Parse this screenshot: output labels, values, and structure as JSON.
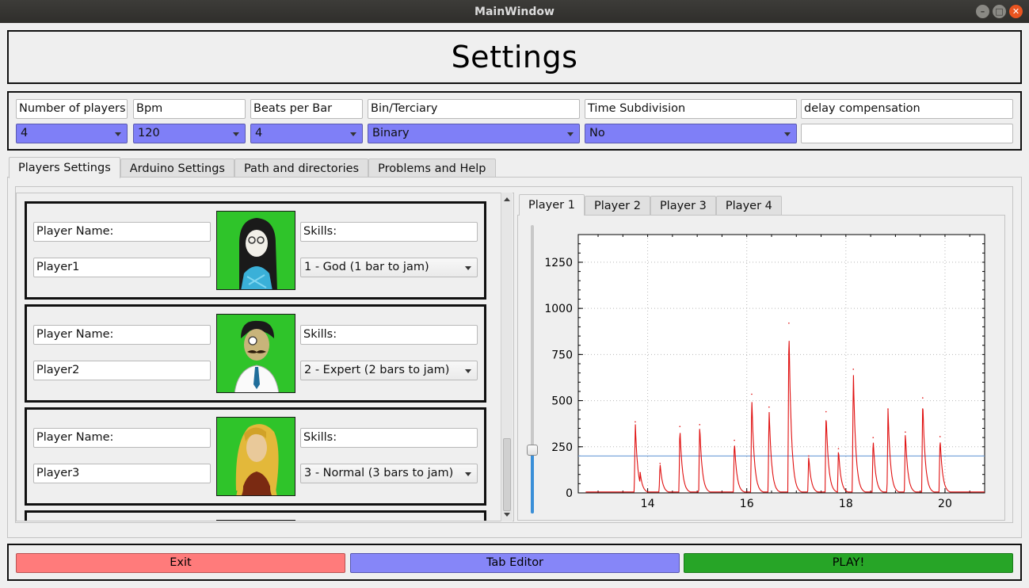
{
  "window": {
    "title": "MainWindow"
  },
  "header": {
    "title": "Settings"
  },
  "params": [
    {
      "label": "Number of players",
      "value": "4",
      "type": "combo"
    },
    {
      "label": "Bpm",
      "value": "120",
      "type": "combo"
    },
    {
      "label": "Beats per Bar",
      "value": "4",
      "type": "combo"
    },
    {
      "label": "Bin/Terciary",
      "value": "Binary",
      "type": "combo"
    },
    {
      "label": "Time Subdivision",
      "value": "No",
      "type": "combo"
    },
    {
      "label": "delay compensation",
      "value": "",
      "type": "edit"
    }
  ],
  "main_tabs": [
    "Players Settings",
    "Arduino Settings",
    "Path and directories",
    "Problems and Help"
  ],
  "players": [
    {
      "name_label": "Player Name:",
      "name": "Player1",
      "skills_label": "Skills:",
      "skill": "1 - God (1 bar to jam)",
      "avatar": "long-black-hair-glasses-avatar"
    },
    {
      "name_label": "Player Name:",
      "name": "Player2",
      "skills_label": "Skills:",
      "skill": "2 - Expert (2 bars to jam)",
      "avatar": "mustache-monocle-avatar"
    },
    {
      "name_label": "Player Name:",
      "name": "Player3",
      "skills_label": "Skills:",
      "skill": "3 - Normal (3 bars to jam)",
      "avatar": "blonde-hair-avatar"
    }
  ],
  "player_tabs": [
    "Player 1",
    "Player 2",
    "Player 3",
    "Player 4"
  ],
  "slider": {
    "level": 0.22
  },
  "chart_data": {
    "type": "line",
    "title": "",
    "xlabel": "",
    "ylabel": "",
    "xlim": [
      12.6,
      20.8
    ],
    "ylim": [
      0,
      1400
    ],
    "xticks": [
      14,
      16,
      18,
      20
    ],
    "yticks": [
      0,
      250,
      500,
      750,
      1000,
      1250
    ],
    "grid": true,
    "threshold": 200,
    "series": [
      {
        "color": "#e01010",
        "peaks": [
          [
            13.75,
            385
          ],
          [
            13.85,
            110
          ],
          [
            14.25,
            160
          ],
          [
            14.65,
            360
          ],
          [
            15.05,
            370
          ],
          [
            15.75,
            285
          ],
          [
            16.1,
            535
          ],
          [
            16.45,
            465
          ],
          [
            16.85,
            920
          ],
          [
            17.25,
            200
          ],
          [
            17.6,
            440
          ],
          [
            17.85,
            240
          ],
          [
            18.15,
            670
          ],
          [
            18.55,
            300
          ],
          [
            18.85,
            455
          ],
          [
            19.2,
            330
          ],
          [
            19.55,
            515
          ],
          [
            19.9,
            305
          ]
        ],
        "baseline": 5
      }
    ]
  },
  "bottom_buttons": [
    {
      "label": "Exit",
      "color": "#ff7b7b"
    },
    {
      "label": "Tab Editor",
      "color": "#8686f8"
    },
    {
      "label": "PLAY!",
      "color": "#27a527"
    }
  ],
  "colors": {
    "combo_accent": "#7f7ff7",
    "plot_threshold": "#6f9fd8"
  }
}
